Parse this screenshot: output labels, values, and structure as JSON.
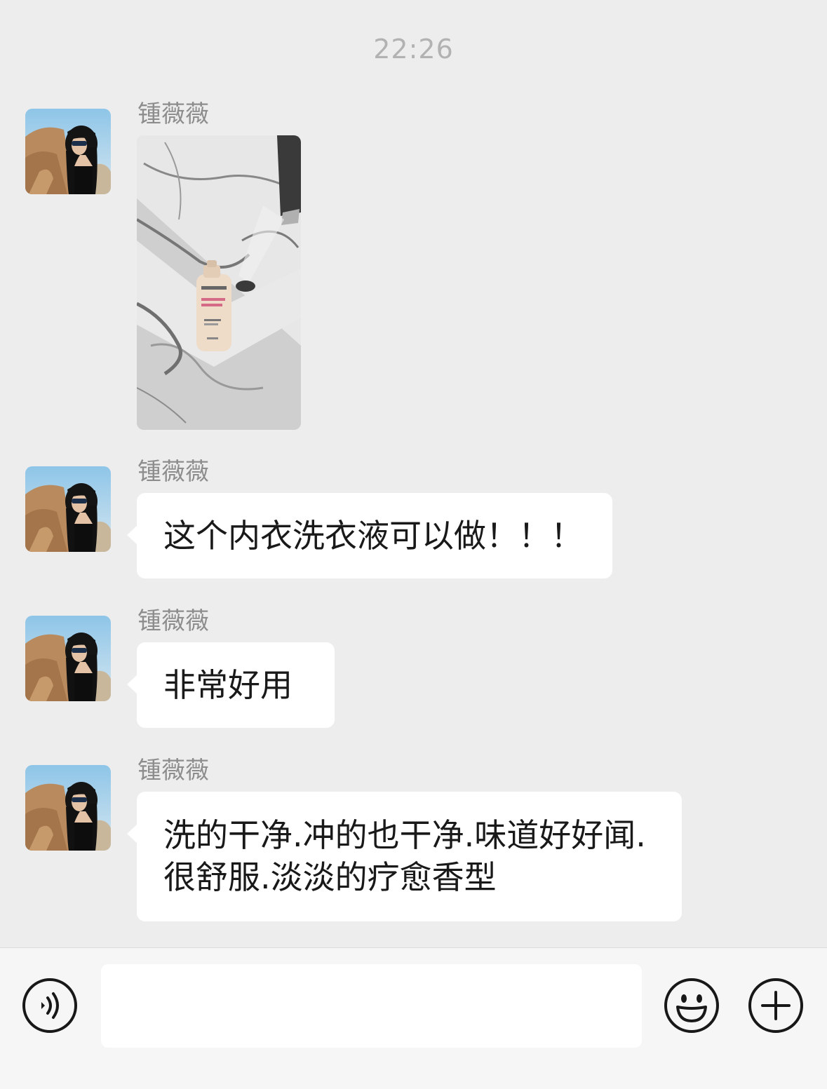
{
  "chat": {
    "timestamp": "22:26",
    "messages": [
      {
        "sender": "锺薇薇",
        "type": "image",
        "image_desc": "bottle-on-marble-photo"
      },
      {
        "sender": "锺薇薇",
        "type": "text",
        "text": "这个内衣洗衣液可以做！！！"
      },
      {
        "sender": "锺薇薇",
        "type": "text",
        "text": "非常好用"
      },
      {
        "sender": "锺薇薇",
        "type": "text",
        "text": "洗的干净.冲的也干净.味道好好闻.很舒服.淡淡的疗愈香型"
      }
    ]
  },
  "input_bar": {
    "voice_icon": "voice-icon",
    "emoji_icon": "emoji-icon",
    "plus_icon": "plus-icon",
    "input_value": ""
  },
  "colors": {
    "background": "#ededed",
    "bubble": "#ffffff",
    "text": "#191919",
    "meta": "#8d8d8d"
  }
}
